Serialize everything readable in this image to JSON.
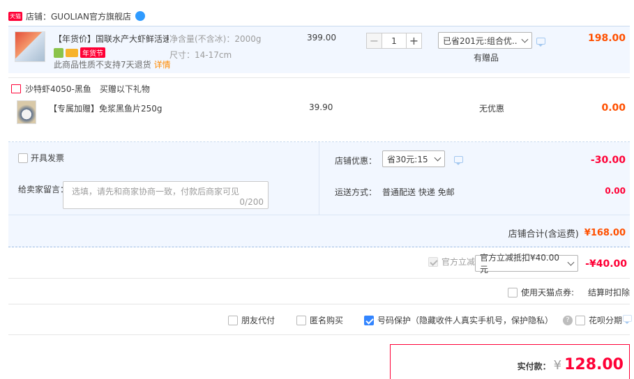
{
  "store": {
    "badge": "天猫",
    "label": "店铺：GUOLIAN官方旗舰店"
  },
  "product": {
    "title": "【年货价】国联水产大虾鲜活速...",
    "tag_festival": "年货节",
    "spec_weight": "净含量(不含冰)：2000g",
    "spec_size": "尺寸：14-17cm",
    "notice": "此商品性质不支持7天退货",
    "notice_link": "详情",
    "price": "399.00",
    "quantity": "1",
    "promo_select": "已省201元:组合优...",
    "gift_note": "有赠品",
    "subtotal": "198.00"
  },
  "gift": {
    "header_item": "沙特虾4050-黑鱼",
    "header_note": "买赠以下礼物",
    "title": "【专属加赠】免浆黑鱼片250g",
    "price": "39.90",
    "promo": "无优惠",
    "subtotal": "0.00"
  },
  "options": {
    "invoice_label": "开具发票",
    "message_label": "给卖家留言：",
    "message_placeholder": "选填，请先和商家协商一致，付款后商家可见",
    "message_count": "0/200",
    "store_discount_label": "店铺优惠：",
    "store_discount_select": "省30元:15",
    "store_discount_value": "-30.00",
    "shipping_label": "运送方式：",
    "shipping_value": "普通配送 快递 免邮",
    "shipping_fee": "0.00",
    "store_total_label": "店铺合计(含运费)",
    "store_total_value": "¥168.00"
  },
  "official": {
    "label": "官方立减",
    "select": "官方立减抵扣¥40.00元",
    "value": "-¥40.00"
  },
  "tmall_points": {
    "label": "使用天猫点券:",
    "value": "结算时扣除"
  },
  "services": {
    "friend_pay": "朋友代付",
    "anonymous": "匿名购买",
    "number_protect": "号码保护（隐藏收件人真实手机号，保护隐私）",
    "huabei": "花呗分期"
  },
  "pay": {
    "label": "实付款：",
    "currency": "¥",
    "amount": "128.00"
  },
  "colors": {
    "accent_red": "#ff0036",
    "accent_orange": "#ff5000",
    "panel_bg": "#f2f7ff",
    "checkbox_blue": "#3385ff"
  }
}
